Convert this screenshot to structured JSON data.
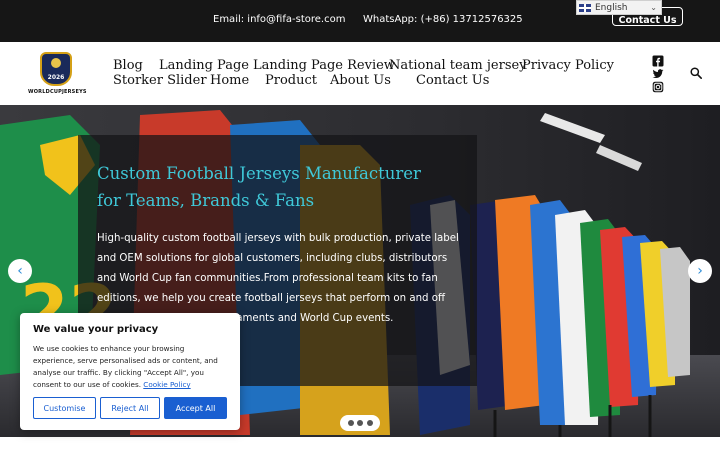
{
  "topbar": {
    "email": "Email: info@fifa-store.com",
    "whatsapp": "WhatsApp: (+86) 13712576325",
    "contact_button": "Contact Us"
  },
  "language": {
    "selected": "English"
  },
  "logo": {
    "year": "2026",
    "wordmark": "WORLDCUPJERSEYS"
  },
  "nav": {
    "row1": [
      "Blog",
      "Landing Page",
      "Landing Page Review",
      "National team jersey",
      "Privacy Policy"
    ],
    "row2": [
      "Storker Slider",
      "Home",
      "Product",
      "About Us",
      "Contact Us"
    ]
  },
  "social_icons": [
    "facebook-icon",
    "twitter-icon",
    "instagram-icon"
  ],
  "hero": {
    "title": "Custom Football Jerseys Manufacturer for Teams, Brands & Fans",
    "description": "High-quality custom football jerseys with bulk production, private label and OEM solutions for global customers, including clubs, distributors and World Cup fan communities.From professional team kits to fan editions, we help you create football jerseys that perform on and off the pitch for leagues, tournaments and World Cup events.",
    "slide_count": 3
  },
  "cookie": {
    "title": "We value your privacy",
    "body": "We use cookies to enhance your browsing experience, serve personalised ads or content, and analyse our traffic. By clicking \"Accept All\", you consent to our use of cookies.",
    "link": "Cookie Policy",
    "customise": "Customise",
    "reject": "Reject All",
    "accept": "Accept All"
  },
  "colors": {
    "hero_title": "#3fc8d8",
    "accent_blue": "#1a5fd1",
    "topbar_bg": "#161616"
  }
}
